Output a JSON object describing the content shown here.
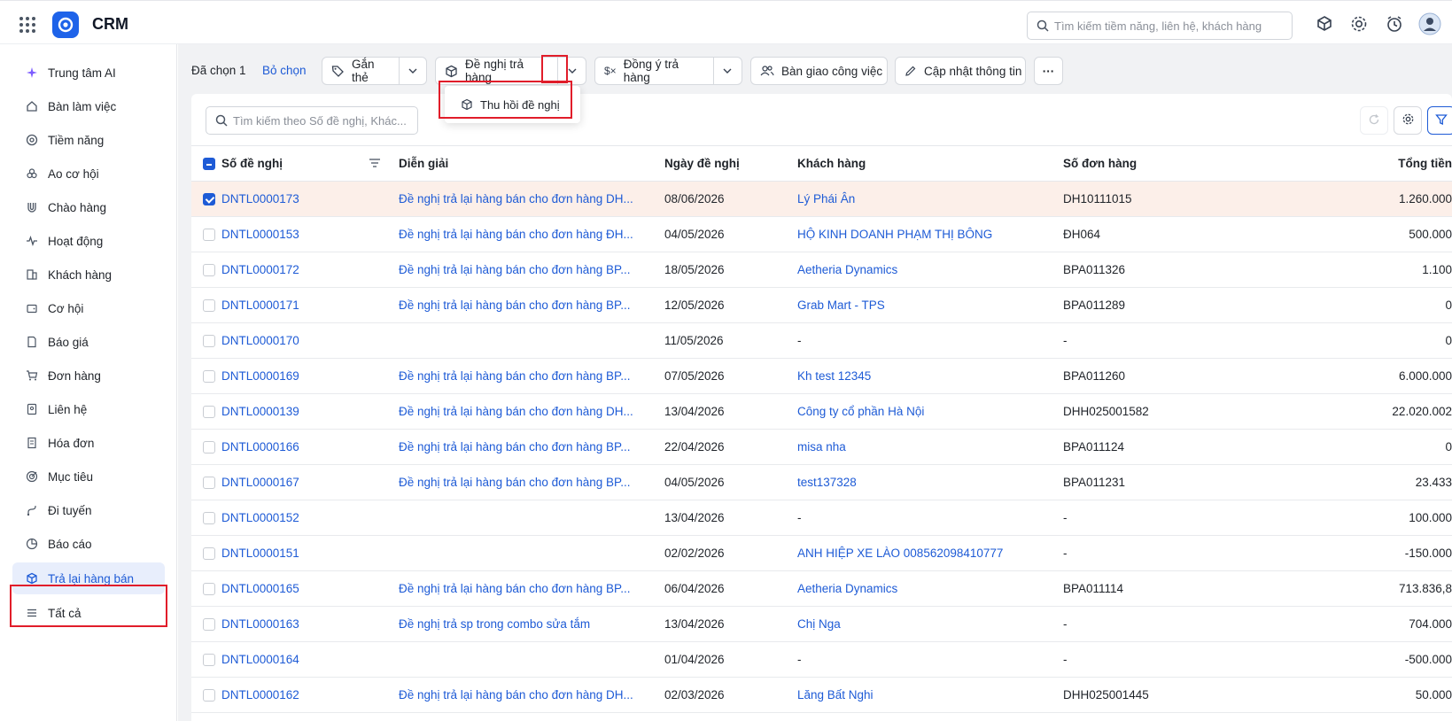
{
  "app": {
    "title": "CRM"
  },
  "search": {
    "placeholder": "Tìm kiếm tiềm năng, liên hệ, khách hàng"
  },
  "sidebar": {
    "items": [
      {
        "label": "Trung tâm AI",
        "icon": "sparkle-icon"
      },
      {
        "label": "Bàn làm việc",
        "icon": "home-icon"
      },
      {
        "label": "Tiềm năng",
        "icon": "target-icon"
      },
      {
        "label": "Ao cơ hội",
        "icon": "group-icon"
      },
      {
        "label": "Chào hàng",
        "icon": "magnet-icon"
      },
      {
        "label": "Hoạt động",
        "icon": "activity-icon"
      },
      {
        "label": "Khách hàng",
        "icon": "building-icon"
      },
      {
        "label": "Cơ hội",
        "icon": "wallet-icon"
      },
      {
        "label": "Báo giá",
        "icon": "quote-icon"
      },
      {
        "label": "Đơn hàng",
        "icon": "cart-icon"
      },
      {
        "label": "Liên hệ",
        "icon": "contact-icon"
      },
      {
        "label": "Hóa đơn",
        "icon": "invoice-icon"
      },
      {
        "label": "Mục tiêu",
        "icon": "goal-icon"
      },
      {
        "label": "Đi tuyến",
        "icon": "route-icon"
      },
      {
        "label": "Báo cáo",
        "icon": "pie-chart-icon"
      },
      {
        "label": "Trả lại hàng bán",
        "icon": "return-box-icon"
      },
      {
        "label": "Tất cả",
        "icon": "menu-icon"
      }
    ],
    "active_index": 15
  },
  "actionbar": {
    "selected_text": "Đã chọn 1",
    "deselect": "Bỏ chọn",
    "tag": "Gắn thẻ",
    "propose_return": "Đề nghị trả hàng",
    "approve_return": "Đồng ý trả hàng",
    "handover": "Bàn giao công việc",
    "update_info": "Cập nhật thông tin",
    "more": "···"
  },
  "dropdown": {
    "item": "Thu hồi đề nghị"
  },
  "list": {
    "search_placeholder": "Tìm kiếm theo Số đề nghị, Khác..."
  },
  "table": {
    "columns": {
      "no": "Số đề nghị",
      "desc": "Diễn giải",
      "date": "Ngày đề nghị",
      "customer": "Khách hàng",
      "order": "Số đơn hàng",
      "total": "Tổng tiền"
    },
    "rows": [
      {
        "no": "DNTL0000173",
        "desc": "Đề nghị trả lại hàng bán cho đơn hàng DH...",
        "date": "08/06/2026",
        "customer": "Lý Phái Ân",
        "order": "DH10111015",
        "total": "1.260.000",
        "checked": true
      },
      {
        "no": "DNTL0000153",
        "desc": "Đề nghị trả lại hàng bán cho đơn hàng ĐH...",
        "date": "04/05/2026",
        "customer": "HỘ KINH DOANH PHẠM THỊ BÔNG",
        "order": "ĐH064",
        "total": "500.000",
        "checked": false
      },
      {
        "no": "DNTL0000172",
        "desc": "Đề nghị trả lại hàng bán cho đơn hàng BP...",
        "date": "18/05/2026",
        "customer": "Aetheria Dynamics",
        "order": "BPA011326",
        "total": "1.100",
        "checked": false
      },
      {
        "no": "DNTL0000171",
        "desc": "Đề nghị trả lại hàng bán cho đơn hàng BP...",
        "date": "12/05/2026",
        "customer": "Grab Mart - TPS",
        "order": "BPA011289",
        "total": "0",
        "checked": false
      },
      {
        "no": "DNTL0000170",
        "desc": "",
        "date": "11/05/2026",
        "customer": "-",
        "order": "-",
        "total": "0",
        "checked": false
      },
      {
        "no": "DNTL0000169",
        "desc": "Đề nghị trả lại hàng bán cho đơn hàng BP...",
        "date": "07/05/2026",
        "customer": "Kh test 12345",
        "order": "BPA011260",
        "total": "6.000.000",
        "checked": false
      },
      {
        "no": "DNTL0000139",
        "desc": "Đề nghị trả lại hàng bán cho đơn hàng DH...",
        "date": "13/04/2026",
        "customer": "Công ty cổ phần Hà Nội",
        "order": "DHH025001582",
        "total": "22.020.002",
        "checked": false
      },
      {
        "no": "DNTL0000166",
        "desc": "Đề nghị trả lại hàng bán cho đơn hàng BP...",
        "date": "22/04/2026",
        "customer": "misa nha",
        "order": "BPA011124",
        "total": "0",
        "checked": false
      },
      {
        "no": "DNTL0000167",
        "desc": "Đề nghị trả lại hàng bán cho đơn hàng BP...",
        "date": "04/05/2026",
        "customer": "test137328",
        "order": "BPA011231",
        "total": "23.433",
        "checked": false
      },
      {
        "no": "DNTL0000152",
        "desc": "",
        "date": "13/04/2026",
        "customer": "-",
        "order": "-",
        "total": "100.000",
        "checked": false
      },
      {
        "no": "DNTL0000151",
        "desc": "",
        "date": "02/02/2026",
        "customer": "ANH HIỆP XE LÀO 008562098410777",
        "order": "-",
        "total": "-150.000",
        "checked": false
      },
      {
        "no": "DNTL0000165",
        "desc": "Đề nghị trả lại hàng bán cho đơn hàng BP...",
        "date": "06/04/2026",
        "customer": "Aetheria Dynamics",
        "order": "BPA011114",
        "total": "713.836,8",
        "checked": false
      },
      {
        "no": "DNTL0000163",
        "desc": "Đề nghị trả sp trong combo sửa tắm",
        "date": "13/04/2026",
        "customer": "Chị Nga",
        "order": "-",
        "total": "704.000",
        "checked": false
      },
      {
        "no": "DNTL0000164",
        "desc": "",
        "date": "01/04/2026",
        "customer": "-",
        "order": "-",
        "total": "-500.000",
        "checked": false
      },
      {
        "no": "DNTL0000162",
        "desc": "Đề nghị trả lại hàng bán cho đơn hàng DH...",
        "date": "02/03/2026",
        "customer": "Lăng Bất Nghi",
        "order": "DHH025001445",
        "total": "50.000",
        "checked": false
      }
    ]
  },
  "colors": {
    "accent": "#1e5bd6",
    "highlight": "#e11d2a",
    "selected_row": "#fcefe9"
  }
}
